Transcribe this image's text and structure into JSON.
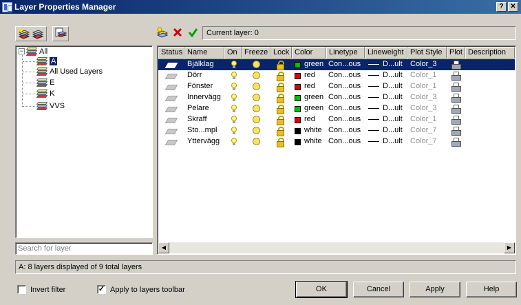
{
  "window": {
    "title": "Layer Properties Manager",
    "help_btn": "?",
    "close_btn": "✕"
  },
  "toolbar": {
    "current_layer": "Current layer: 0"
  },
  "tree": {
    "root": {
      "expander": "−",
      "label": "All"
    },
    "items": [
      {
        "label": "A",
        "selected": true
      },
      {
        "label": "All Used Layers",
        "selected": false
      },
      {
        "label": "E",
        "selected": false
      },
      {
        "label": "K",
        "selected": false
      },
      {
        "label": "VVS",
        "selected": false
      }
    ]
  },
  "search": {
    "placeholder": "Search for layer"
  },
  "columns": {
    "status": "Status",
    "name": "Name",
    "on": "On",
    "freeze": "Freeze",
    "lock": "Lock",
    "color": "Color",
    "linetype": "Linetype",
    "lineweight": "Lineweight",
    "plotstyle": "Plot Style",
    "plot": "Plot",
    "description": "Description"
  },
  "layers": [
    {
      "name": "Bjälklag",
      "color": "green",
      "color_hex": "#00c000",
      "linetype": "Con...ous",
      "lineweight": "D...ult",
      "plotstyle": "Color_3"
    },
    {
      "name": "Dörr",
      "color": "red",
      "color_hex": "#e00000",
      "linetype": "Con...ous",
      "lineweight": "D...ult",
      "plotstyle": "Color_1"
    },
    {
      "name": "Fönster",
      "color": "red",
      "color_hex": "#e00000",
      "linetype": "Con...ous",
      "lineweight": "D...ult",
      "plotstyle": "Color_1"
    },
    {
      "name": "Innervägg",
      "color": "green",
      "color_hex": "#00c000",
      "linetype": "Con...ous",
      "lineweight": "D...ult",
      "plotstyle": "Color_3"
    },
    {
      "name": "Pelare",
      "color": "green",
      "color_hex": "#00c000",
      "linetype": "Con...ous",
      "lineweight": "D...ult",
      "plotstyle": "Color_3"
    },
    {
      "name": "Skraff",
      "color": "red",
      "color_hex": "#e00000",
      "linetype": "Con...ous",
      "lineweight": "D...ult",
      "plotstyle": "Color_1"
    },
    {
      "name": "Sto...mpl",
      "color": "white",
      "color_hex": "#000000",
      "linetype": "Con...ous",
      "lineweight": "D...ult",
      "plotstyle": "Color_7"
    },
    {
      "name": "Yttervägg",
      "color": "white",
      "color_hex": "#000000",
      "linetype": "Con...ous",
      "lineweight": "D...ult",
      "plotstyle": "Color_7"
    }
  ],
  "statusbar": {
    "text": "A: 8 layers displayed of 9 total layers"
  },
  "options": {
    "invert_filter": "Invert filter",
    "apply_toolbar": "Apply to layers toolbar",
    "invert_checked": false,
    "apply_checked": true
  },
  "buttons": {
    "ok": "OK",
    "cancel": "Cancel",
    "apply": "Apply",
    "help": "Help"
  },
  "scroll": {
    "left": "◀",
    "right": "▶"
  },
  "colors": {
    "title_bar": "#0a246a",
    "selection": "#0a246a",
    "dialog": "#d4d0c8"
  }
}
